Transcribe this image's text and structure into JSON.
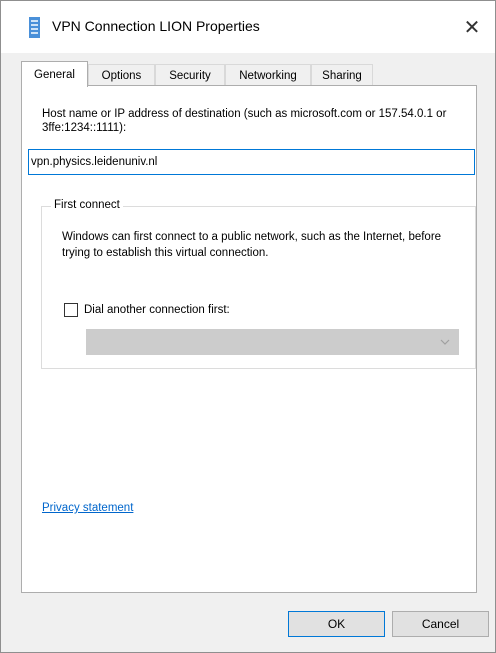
{
  "window": {
    "title": "VPN Connection LION Properties",
    "title_icon": "vpn-connection-icon",
    "close_icon": "close-icon",
    "close_glyph": "✕"
  },
  "tabs": [
    {
      "label": "General",
      "active": true
    },
    {
      "label": "Options",
      "active": false
    },
    {
      "label": "Security",
      "active": false
    },
    {
      "label": "Networking",
      "active": false
    },
    {
      "label": "Sharing",
      "active": false
    }
  ],
  "general": {
    "host_label": "Host name or IP address of destination (such as microsoft.com or 157.54.0.1 or 3ffe:1234::1111):",
    "host_value": "vpn.physics.leidenuniv.nl",
    "first_connect": {
      "legend": "First connect",
      "description": "Windows can first connect to a public network, such as the Internet, before trying to establish this virtual connection.",
      "checkbox_label": "Dial another connection first:",
      "checkbox_checked": false,
      "dropdown_value": "",
      "dropdown_enabled": false
    },
    "privacy_link": "Privacy statement"
  },
  "buttons": {
    "ok": "OK",
    "cancel": "Cancel"
  },
  "colors": {
    "accent": "#0078d7",
    "link": "#0066cc",
    "disabled_dropdown": "#cccccc"
  }
}
